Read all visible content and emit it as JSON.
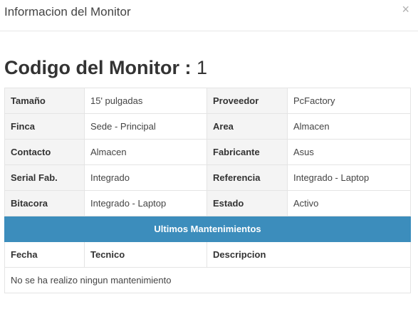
{
  "modal": {
    "title": "Informacion del Monitor",
    "close_label": "×"
  },
  "heading": {
    "label": "Codigo del Monitor :",
    "value": "1"
  },
  "details": [
    {
      "label_left": "Tamaño",
      "value_left": "15' pulgadas",
      "label_right": "Proveedor",
      "value_right": "PcFactory"
    },
    {
      "label_left": "Finca",
      "value_left": "Sede - Principal",
      "label_right": "Area",
      "value_right": "Almacen"
    },
    {
      "label_left": "Contacto",
      "value_left": "Almacen",
      "label_right": "Fabricante",
      "value_right": "Asus"
    },
    {
      "label_left": "Serial Fab.",
      "value_left": "Integrado",
      "label_right": "Referencia",
      "value_right": "Integrado - Laptop"
    },
    {
      "label_left": "Bitacora",
      "value_left": "Integrado - Laptop",
      "label_right": "Estado",
      "value_right": "Activo"
    }
  ],
  "maintenance": {
    "title": "Ultimos Mantenimientos",
    "columns": [
      "Fecha",
      "Tecnico",
      "Descripcion"
    ],
    "empty_message": "No se ha realizo ningun mantenimiento"
  },
  "colors": {
    "banner": "#3c8dbc"
  }
}
